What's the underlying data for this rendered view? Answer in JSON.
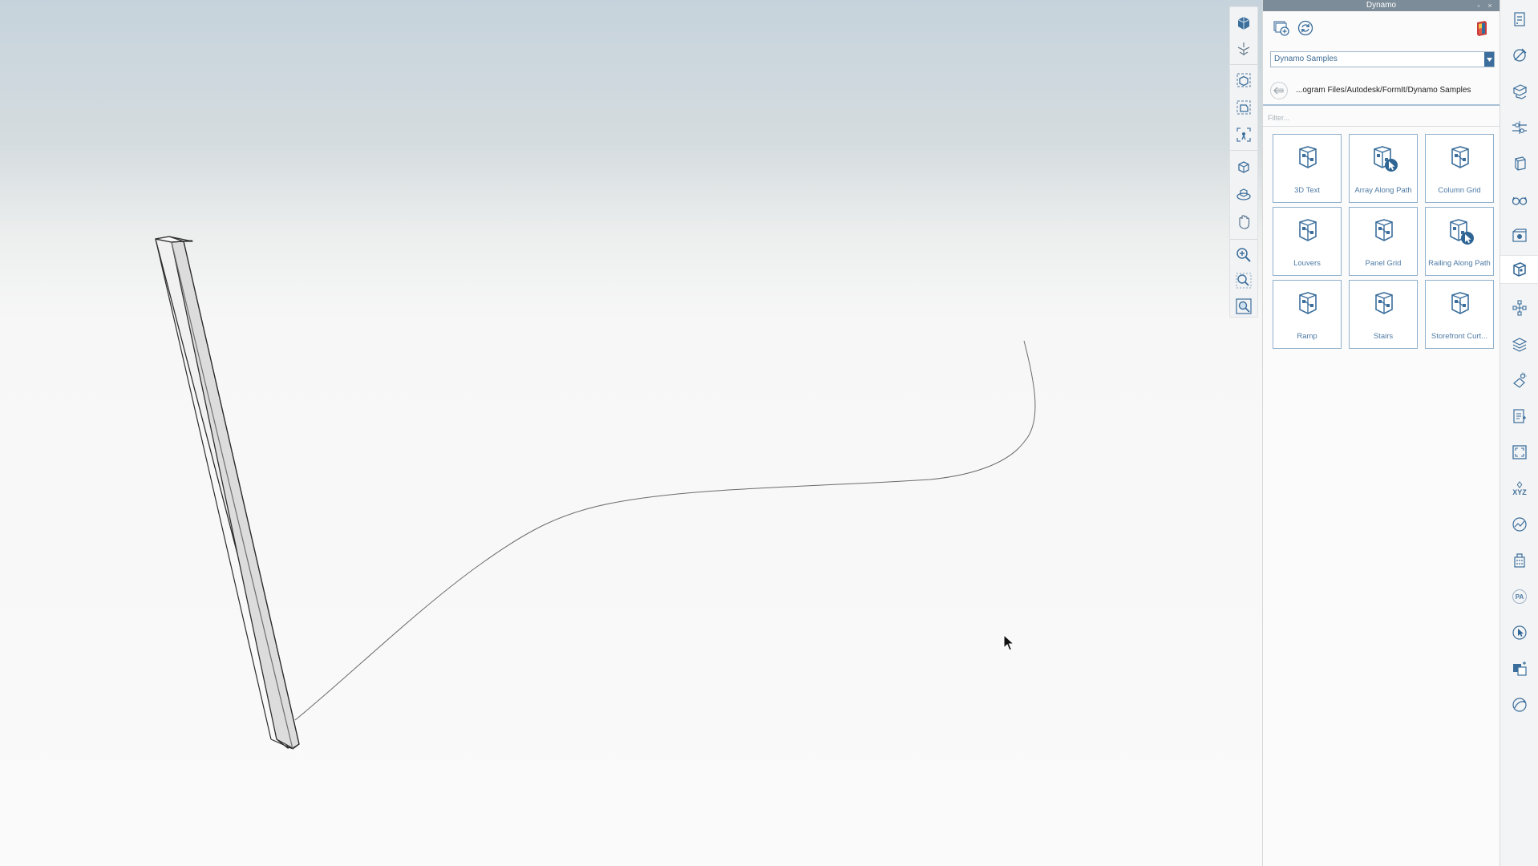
{
  "panel": {
    "title": "Dynamo",
    "titlebar_controls": {
      "restore": "▫",
      "close": "×"
    },
    "toolbar": {
      "new_button_icon": "add-graph-icon",
      "refresh_button_icon": "refresh-icon",
      "dynamo_icon": "dynamo-logo-icon"
    },
    "source_select": {
      "selected": "Dynamo Samples"
    },
    "path": "...ogram Files/Autodesk/FormIt/Dynamo Samples",
    "filter": {
      "placeholder": "Filter..."
    },
    "samples": [
      {
        "label": "3D Text",
        "icon": "graph-icon"
      },
      {
        "label": "Array Along Path",
        "icon": "graph-select-icon"
      },
      {
        "label": "Column Grid",
        "icon": "graph-icon"
      },
      {
        "label": "Louvers",
        "icon": "graph-icon"
      },
      {
        "label": "Panel Grid",
        "icon": "graph-icon"
      },
      {
        "label": "Railing Along Path",
        "icon": "graph-select-icon"
      },
      {
        "label": "Ramp",
        "icon": "graph-icon"
      },
      {
        "label": "Stairs",
        "icon": "graph-icon"
      },
      {
        "label": "Storefront Curt...",
        "icon": "graph-icon"
      }
    ]
  },
  "strip": {
    "active_index": 7,
    "items": [
      {
        "icon": "properties-icon"
      },
      {
        "icon": "materials-icon"
      },
      {
        "icon": "layers-icon"
      },
      {
        "icon": "levels-icon"
      },
      {
        "icon": "groups-icon"
      },
      {
        "icon": "view-settings-icon"
      },
      {
        "icon": "scenes-icon"
      },
      {
        "icon": "dynamo-icon"
      },
      {
        "icon": "hierarchy-icon"
      },
      {
        "icon": "stack-icon"
      },
      {
        "icon": "sun-icon"
      },
      {
        "icon": "notes-icon"
      },
      {
        "icon": "frame-icon"
      },
      {
        "icon": "xyz-icon",
        "text": "XYZ"
      },
      {
        "icon": "analysis-icon"
      },
      {
        "icon": "building-icon"
      },
      {
        "icon": "pa-icon",
        "text": "PA"
      },
      {
        "icon": "pointer-icon"
      },
      {
        "icon": "image-icon"
      },
      {
        "icon": "curve-icon"
      }
    ]
  },
  "navbar": {
    "groups": [
      [
        "view-cube-icon",
        "view-orient-icon"
      ],
      [
        "perspective-icon",
        "orthographic-icon",
        "fit-view-icon"
      ],
      [
        "orbit-icon",
        "look-icon",
        "pan-icon"
      ],
      [
        "zoom-in-icon",
        "zoom-out-icon",
        "zoom-extents-icon"
      ]
    ]
  },
  "colors": {
    "accent": "#3b6e9c",
    "tile_border": "#8fb0cd",
    "tile_label": "#4f7ba5",
    "titlebar": "#7c8c98",
    "sky_top": "#c6d3dc",
    "ground": "#fafafa"
  }
}
